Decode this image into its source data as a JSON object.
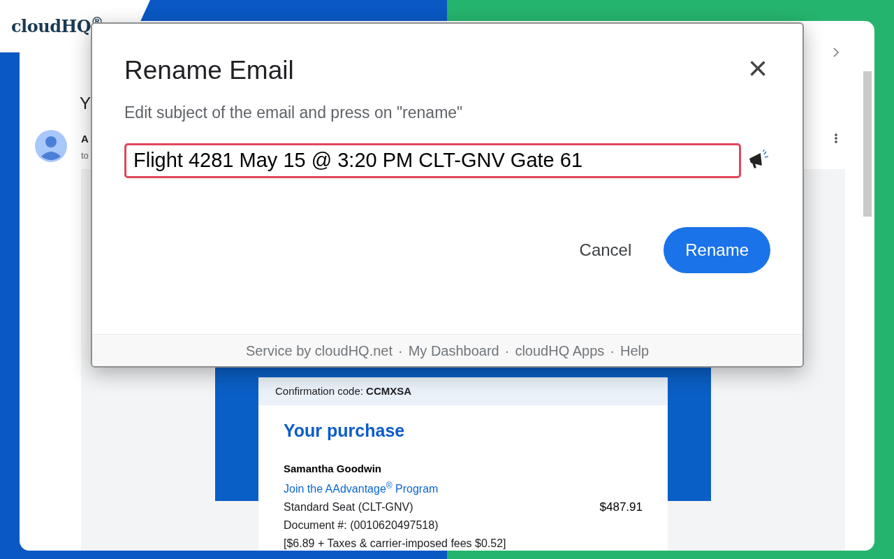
{
  "brand": {
    "logo": "cloudHQ$^{®}$"
  },
  "email": {
    "subject": "Y",
    "sender": "A",
    "recipient": "to",
    "confirmation": "Confirmation code: **CCMXSA**",
    "heading": "Your purchase",
    "passenger": "Samantha Goodwin",
    "link": "Join the AAdvantage$^{®}$ Program",
    "items": [
      {
        "label": "Standard Seat (CLT-GNV)",
        "price": "$487.91"
      },
      {
        "label": "Document #: (0010620497518)"
      },
      {
        "label": "[$6.89 + Taxes & carrier-imposed fees $0.52]"
      }
    ]
  },
  "dialog": {
    "title": "Rename Email",
    "close": "×",
    "instructions": "Edit subject of the email and press on \"rename\"",
    "subject_value": "Flight 4281 May 15 @ 3:20 PM CLT-GNV Gate 61",
    "buttons": [
      {
        "label": "Cancel",
        "kind": "text"
      },
      {
        "label": "Rename",
        "kind": "primary"
      }
    ],
    "footer": [
      {
        "label": "Service by cloudHQ.net"
      },
      {
        "label": "My Dashboard"
      },
      {
        "label": "cloudHQ Apps"
      },
      {
        "label": "Help"
      }
    ],
    "separator": "·"
  }
}
